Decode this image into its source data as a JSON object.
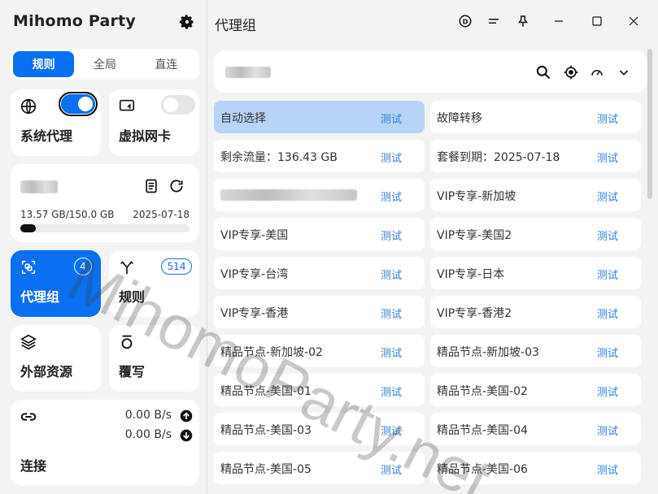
{
  "app": {
    "name": "Mihomo Party"
  },
  "sidebar": {
    "modes": [
      "规则",
      "全局",
      "直连"
    ],
    "system_proxy_label": "系统代理",
    "tun_label": "虚拟网卡",
    "profile": {
      "usage": "13.57 GB/150.0 GB",
      "expire": "2025-07-18",
      "usage_fraction": 0.09
    },
    "proxy_groups_label": "代理组",
    "proxy_groups_count": "4",
    "rules_label": "规则",
    "rules_count": "514",
    "resources_label": "外部资源",
    "override_label": "覆写",
    "connections": {
      "label": "连接",
      "upload": "0.00 B/s",
      "download": "0.00 B/s"
    }
  },
  "main": {
    "title": "代理组",
    "proxies": [
      {
        "name": "自动选择",
        "test": "测试",
        "selected": true
      },
      {
        "name": "故障转移",
        "test": "测试"
      },
      {
        "name": "剩余流量：136.43 GB",
        "test": "测试"
      },
      {
        "name": "套餐到期：2025-07-18",
        "test": "测试"
      },
      {
        "name": "",
        "test": "测试",
        "blurred": true
      },
      {
        "name": "VIP专享-新加坡",
        "test": "测试"
      },
      {
        "name": "VIP专享-美国",
        "test": "测试"
      },
      {
        "name": "VIP专享-美国2",
        "test": "测试"
      },
      {
        "name": "VIP专享-台湾",
        "test": "测试"
      },
      {
        "name": "VIP专享-日本",
        "test": "测试"
      },
      {
        "name": "VIP专享-香港",
        "test": "测试"
      },
      {
        "name": "VIP专享-香港2",
        "test": "测试"
      },
      {
        "name": "精品节点-新加坡-02",
        "test": "测试"
      },
      {
        "name": "精品节点-新加坡-03",
        "test": "测试"
      },
      {
        "name": "精品节点-美国-01",
        "test": "测试"
      },
      {
        "name": "精品节点-美国-02",
        "test": "测试"
      },
      {
        "name": "精品节点-美国-03",
        "test": "测试"
      },
      {
        "name": "精品节点-美国-04",
        "test": "测试"
      },
      {
        "name": "精品节点-美国-05",
        "test": "测试"
      },
      {
        "name": "精品节点-美国-06",
        "test": "测试"
      }
    ]
  },
  "watermark": "MihomoParty.net"
}
